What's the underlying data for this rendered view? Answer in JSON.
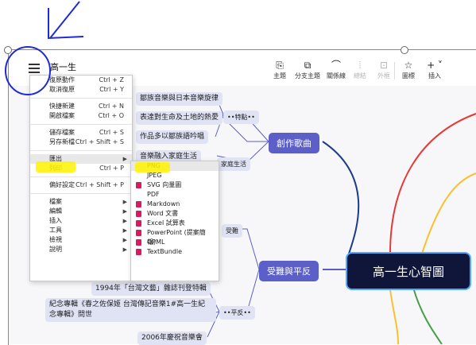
{
  "document": {
    "title": "高一生"
  },
  "toolbar": {
    "tools": [
      {
        "key": "topic",
        "label": "主題",
        "icon": "topic-icon",
        "glyph": "⎘",
        "disabled": false
      },
      {
        "key": "subtopic",
        "label": "分支主題",
        "icon": "subtopic-icon",
        "glyph": "⧉",
        "disabled": false
      },
      {
        "key": "relationship",
        "label": "關係線",
        "icon": "relationship-icon",
        "glyph": "⌒",
        "disabled": false
      },
      {
        "key": "boundary",
        "label": "總結",
        "icon": "summary-icon",
        "glyph": "⦙",
        "disabled": true
      },
      {
        "key": "outline",
        "label": "外框",
        "icon": "boundary-icon",
        "glyph": "⊡",
        "disabled": true
      },
      {
        "key": "marker",
        "label": "圖標",
        "icon": "star-icon",
        "glyph": "☆",
        "disabled": false
      },
      {
        "key": "insert",
        "label": "插入",
        "icon": "plus-icon",
        "glyph": "+ ˅",
        "disabled": false
      }
    ]
  },
  "main_menu": {
    "items": [
      {
        "label": "復原動作",
        "shortcut": "Ctrl + Z"
      },
      {
        "label": "取消復原",
        "shortcut": "Ctrl + Y"
      },
      {
        "sep": true
      },
      {
        "label": "快捷新建",
        "shortcut": "Ctrl + N"
      },
      {
        "label": "開啟檔案",
        "shortcut": "Ctrl + O"
      },
      {
        "sep": true
      },
      {
        "label": "儲存檔案",
        "shortcut": "Ctrl + S"
      },
      {
        "label": "另存新檔",
        "shortcut": "Ctrl + Shift + S"
      },
      {
        "sep": true
      },
      {
        "label": "匯出",
        "submenu": true,
        "highlighted": true
      },
      {
        "label": "列印",
        "shortcut": "Ctrl + P"
      },
      {
        "sep": true
      },
      {
        "label": "偏好設定",
        "shortcut": "Ctrl + Shift + P"
      },
      {
        "sep": true
      },
      {
        "label": "檔案",
        "submenu": true
      },
      {
        "label": "編輯",
        "submenu": true
      },
      {
        "label": "插入",
        "submenu": true
      },
      {
        "label": "工具",
        "submenu": true
      },
      {
        "label": "檢視",
        "submenu": true
      },
      {
        "label": "說明",
        "submenu": true
      }
    ]
  },
  "export_menu": {
    "items": [
      {
        "label": "PNG",
        "icon": "",
        "highlighted": true
      },
      {
        "label": "JPEG",
        "icon": ""
      },
      {
        "label": "SVG 向量圖",
        "icon": "file-icon"
      },
      {
        "label": "PDF",
        "icon": ""
      },
      {
        "label": "Markdown",
        "icon": "file-icon"
      },
      {
        "label": "Word 文書",
        "icon": "file-icon"
      },
      {
        "label": "Excel 試算表",
        "icon": "file-icon"
      },
      {
        "label": "PowerPoint (提案簡報)",
        "icon": "file-icon"
      },
      {
        "label": "OPML",
        "icon": "file-icon"
      },
      {
        "label": "TextBundle",
        "icon": "file-icon"
      }
    ]
  },
  "mindmap": {
    "central": "高一生心智圖",
    "branches": {
      "creation": "創作歌曲",
      "suffering": "受難與平反"
    },
    "labels": {
      "features": "••特點••",
      "family_life": "家庭生活",
      "suffering_short": "受難",
      "rehab": "••平反••"
    },
    "topics": {
      "t1": "鄒族音樂與日本音樂旋律",
      "t2": "表達對生命及土地的熱愛",
      "t3": "作品多以鄒族語吟唱",
      "t4": "音樂融入家庭生活",
      "t5": "1994年「台灣文藝」雜誌刊登特輯",
      "t6": "紀念專輯《春之佐保姬 台灣傳記音樂1#高一生紀念專輯》問世",
      "t7": "2006年慶祝音樂會"
    }
  },
  "colors": {
    "branch": "#5b5fc7",
    "central": "#10163a",
    "topic_bg": "#dfe3f4",
    "highlight": "#fff200",
    "annotation": "#1f2bd6"
  }
}
